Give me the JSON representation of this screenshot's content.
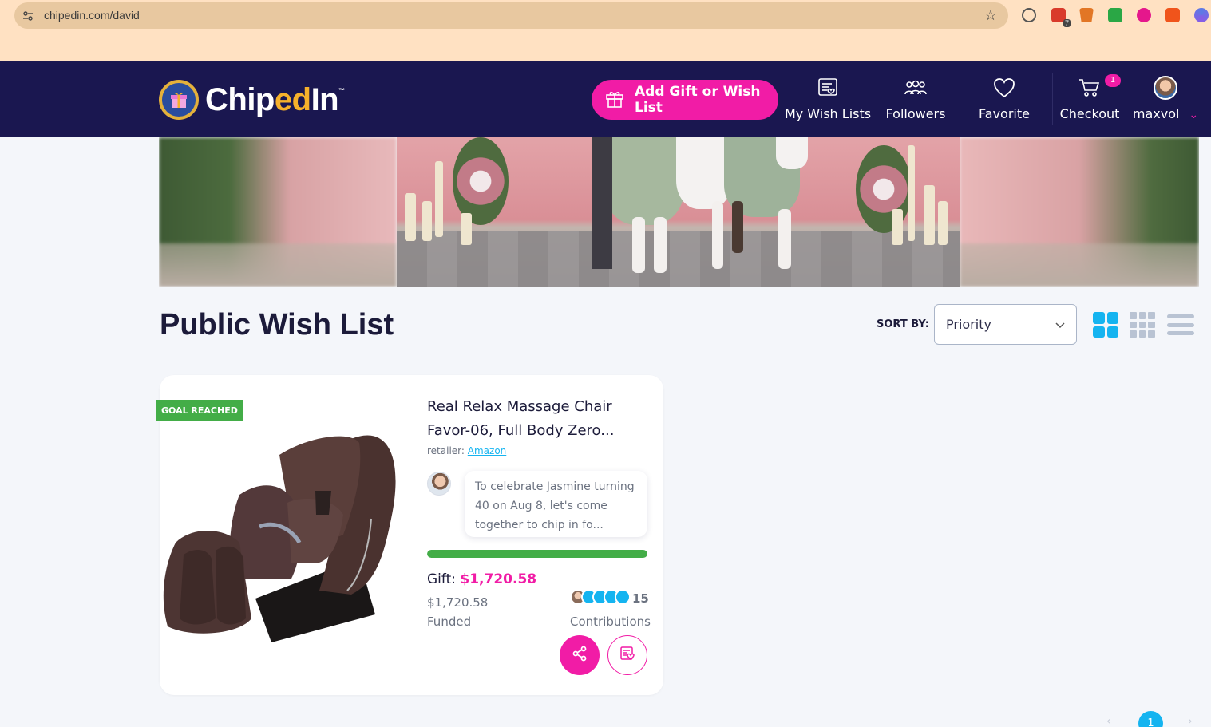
{
  "browser": {
    "url": "chipedin.com/david",
    "extension_badge": "7"
  },
  "header": {
    "logo_text_1": "Chip",
    "logo_text_2": "ed",
    "logo_text_3": "In",
    "logo_tm": "™",
    "add_button_label": "Add Gift or Wish List",
    "nav": {
      "wish_lists": "My Wish Lists",
      "followers": "Followers",
      "favorite": "Favorite",
      "checkout": "Checkout",
      "checkout_badge": "1",
      "user": "maxvol"
    }
  },
  "page": {
    "title": "Public Wish List",
    "sort_label": "SORT BY:",
    "sort_value": "Priority"
  },
  "card": {
    "badge": "GOAL REACHED",
    "title": "Real Relax Massage Chair Favor-06, Full Body Zero...",
    "retailer_label": "retailer:",
    "retailer_name": "Amazon",
    "message": "To celebrate Jasmine turning 40 on Aug 8, let's come together to chip in fo...",
    "progress": 1.0,
    "gift_label": "Gift:",
    "gift_price": "$1,720.58",
    "funded_amount": "$1,720.58",
    "funded_label": "Funded",
    "contributions_count": "15",
    "contributions_label": "Contributions"
  },
  "pagination": {
    "current": "1",
    "prev": "‹",
    "next": "›"
  },
  "colors": {
    "accent": "#f11ca6",
    "header_bg": "#1a1750",
    "success": "#43ad47",
    "info": "#15b4f0"
  }
}
